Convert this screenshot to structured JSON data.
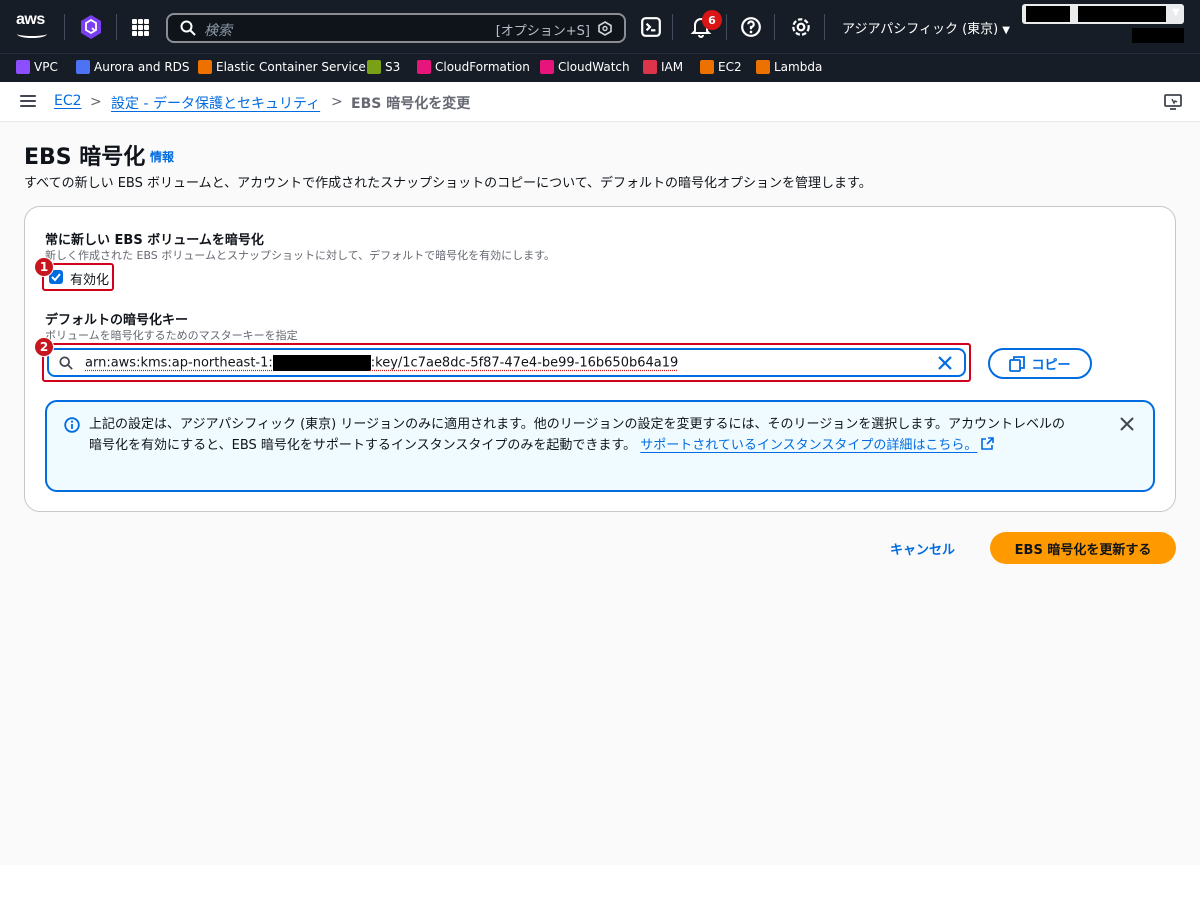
{
  "topnav": {
    "logo_text": "aws",
    "search": {
      "placeholder": "検索",
      "shortcut": "[オプション+S]"
    },
    "notification_count": "6",
    "region": "アジアパシフィック (東京)"
  },
  "favorites": [
    {
      "label": "VPC",
      "color": "#8c4fff"
    },
    {
      "label": "Aurora and RDS",
      "color": "#4d72f3"
    },
    {
      "label": "Elastic Container Service",
      "color": "#ed7100"
    },
    {
      "label": "S3",
      "color": "#7aa116"
    },
    {
      "label": "CloudFormation",
      "color": "#e7157b"
    },
    {
      "label": "CloudWatch",
      "color": "#e7157b"
    },
    {
      "label": "IAM",
      "color": "#dd344c"
    },
    {
      "label": "EC2",
      "color": "#ed7100"
    },
    {
      "label": "Lambda",
      "color": "#ed7100"
    }
  ],
  "breadcrumb": {
    "items": [
      "EC2",
      "設定 - データ保護とセキュリティ",
      "EBS 暗号化を変更"
    ]
  },
  "page": {
    "title": "EBS 暗号化",
    "info": "情報",
    "description": "すべての新しい EBS ボリュームと、アカウントで作成されたスナップショットのコピーについて、デフォルトの暗号化オプションを管理します。"
  },
  "form": {
    "always_encrypt_label": "常に新しい EBS ボリュームを暗号化",
    "always_encrypt_desc": "新しく作成された EBS ボリュームとスナップショットに対して、デフォルトで暗号化を有効にします。",
    "enable_label": "有効化",
    "enable_checked": true,
    "key_label": "デフォルトの暗号化キー",
    "key_desc": "ボリュームを暗号化するためのマスターキーを指定",
    "key_prefix": "arn:aws:kms:ap-northeast-1:",
    "key_suffix": ":key/1c7ae8dc-5f87-47e4-be99-16b650b64a19",
    "copy_label": "コピー",
    "badge1": "1",
    "badge2": "2"
  },
  "alert": {
    "text": "上記の設定は、アジアパシフィック (東京) リージョンのみに適用されます。他のリージョンの設定を変更するには、そのリージョンを選択します。アカウントレベルの暗号化を有効にすると、EBS 暗号化をサポートするインスタンスタイプのみを起動できます。",
    "link": "サポートされているインスタンスタイプの詳細はこちら。"
  },
  "actions": {
    "cancel": "キャンセル",
    "submit": "EBS 暗号化を更新する"
  }
}
